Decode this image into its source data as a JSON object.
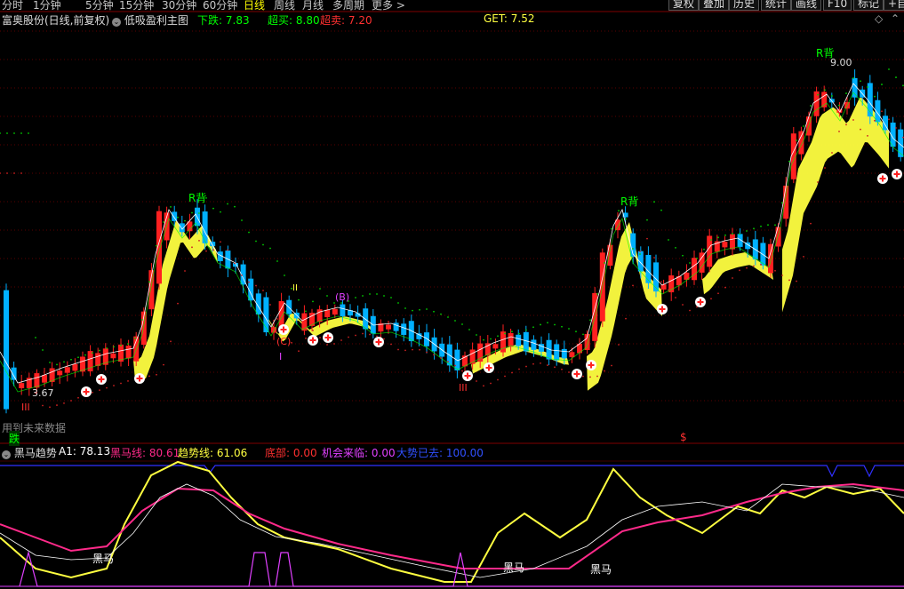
{
  "periods": [
    "分时",
    "1分钟",
    "5分钟",
    "15分钟",
    "30分钟",
    "60分钟",
    "日线",
    "周线",
    "月线",
    "多周期",
    "更多 >"
  ],
  "active_period": "日线",
  "toolbar": {
    "restore": "复权",
    "overlay": "叠加",
    "history": "历史",
    "stats": "统计",
    "draw": "画线",
    "f10": "F10",
    "mark": "标记",
    "plus": "+自"
  },
  "main": {
    "title": "富奥股份(日线,前复权)",
    "formula": "低吸盈利主图",
    "down_label": "下跌:",
    "down_value": "7.83",
    "overbuy_label": "超买:",
    "overbuy_value": "8.80",
    "oversell_label": "超卖:",
    "oversell_value": "7.20",
    "get_label": "GET:",
    "get_value": "7.52",
    "future_note": "用到未来数据",
    "fall_tag": "跌",
    "high_label": "9.00",
    "low_label": "3.67",
    "r_back": "R背",
    "wave_c": "(C)",
    "wave_b": "(B)",
    "wave_i": "I",
    "wave_ii": "II",
    "wave_iii": "III",
    "dollar": "$"
  },
  "indicator": {
    "name": "黑马趋势",
    "a1_label": "A1:",
    "a1_value": "78.13",
    "hm_label": "黑马线:",
    "hm_value": "80.61",
    "trend_label": "趋势线:",
    "trend_value": "61.06",
    "bottom_label": "底部:",
    "bottom_value": "0.00",
    "chance_label": "机会来临:",
    "chance_value": "0.00",
    "gone_label": "大势已去:",
    "gone_value": "100.00",
    "hm_tag": "黑马"
  },
  "colors": {
    "up": "#ff2020",
    "down": "#00b0ff",
    "yellow": "#ffff40",
    "green": "#00ff00",
    "magenta": "#ff2a8a",
    "blue": "#3030ff"
  }
}
